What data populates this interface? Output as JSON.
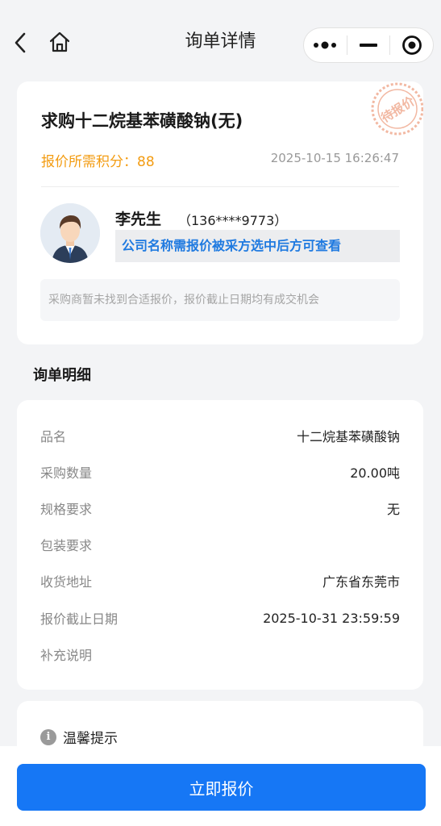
{
  "nav": {
    "title": "询单详情",
    "back_icon": "chevron-left-icon",
    "home_icon": "home-icon",
    "capsule": {
      "more_icon": "more-dots-icon",
      "minimize_icon": "minimize-icon",
      "close_icon": "target-close-icon"
    }
  },
  "inquiry": {
    "title": "求购十二烷基苯磺酸钠(无)",
    "stamp_text": "待报价",
    "points_label": "报价所需积分：",
    "points_value": "88",
    "timestamp": "2025-10-15 16:26:47",
    "buyer_name": "李先生",
    "buyer_phone": "（136****9773）",
    "company_note": "公司名称需报价被采方选中后方可查看",
    "tip": "采购商暂未找到合适报价，报价截止日期均有成交机会"
  },
  "details": {
    "section_title": "询单明细",
    "rows": [
      {
        "label": "品名",
        "value": "十二烷基苯磺酸钠"
      },
      {
        "label": "采购数量",
        "value": "20.00吨"
      },
      {
        "label": "规格要求",
        "value": "无"
      },
      {
        "label": "包装要求",
        "value": ""
      },
      {
        "label": "收货地址",
        "value": "广东省东莞市"
      },
      {
        "label": "报价截止日期",
        "value": "2025-10-31 23:59:59"
      },
      {
        "label": "补充说明",
        "value": ""
      }
    ]
  },
  "tips": {
    "icon": "info-icon",
    "title": "温馨提示"
  },
  "action": {
    "quote_button": "立即报价"
  },
  "colors": {
    "accent": "#1677f5",
    "orange": "#f39c12",
    "stamp": "#f2b8a2"
  }
}
